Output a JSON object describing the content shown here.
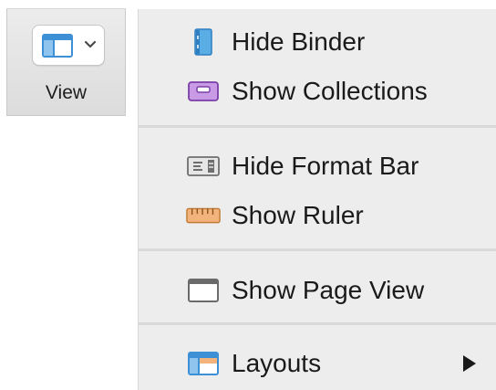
{
  "toolbar": {
    "view_button_label": "View"
  },
  "menu": {
    "items": [
      {
        "label": "Hide Binder",
        "icon": "binder-icon"
      },
      {
        "label": "Show Collections",
        "icon": "collections-icon"
      },
      {
        "label": "Hide Format Bar",
        "icon": "format-bar-icon"
      },
      {
        "label": "Show Ruler",
        "icon": "ruler-icon"
      },
      {
        "label": "Show Page View",
        "icon": "page-view-icon"
      },
      {
        "label": "Layouts",
        "icon": "layouts-icon",
        "has_submenu": true
      }
    ]
  },
  "colors": {
    "binder_blue": "#5aaee6",
    "collections_purple": "#c99be6",
    "ruler_orange": "#e9a462",
    "menu_bg": "#ededed"
  }
}
